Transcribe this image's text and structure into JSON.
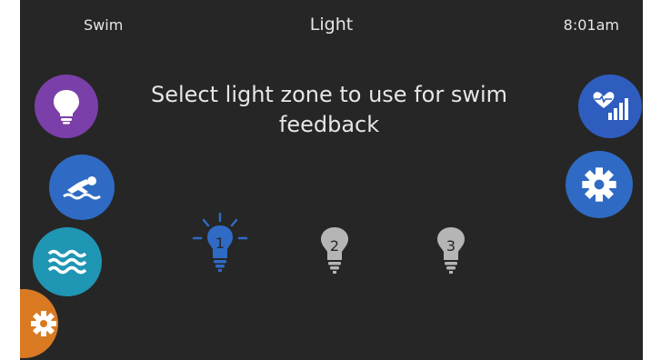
{
  "header": {
    "mode": "Swim",
    "title": "Light",
    "time": "8:01am"
  },
  "prompt": "Select light zone to use for swim feedback",
  "sidebar_left": [
    {
      "icon": "lightbulb-icon",
      "color": "#7a3fa8"
    },
    {
      "icon": "swimmer-icon",
      "color": "#2f6bc4"
    },
    {
      "icon": "waves-icon",
      "color": "#1f96b3"
    },
    {
      "icon": "gear-icon",
      "color": "#d97a22"
    }
  ],
  "sidebar_right": [
    {
      "icon": "heart-signal-icon",
      "color": "#2f5dbf"
    },
    {
      "icon": "gear-icon",
      "color": "#2f6bc4"
    }
  ],
  "zones": [
    {
      "number": "1",
      "selected": true,
      "color": "#2f6bc4"
    },
    {
      "number": "2",
      "selected": false,
      "color": "#b5b5b5"
    },
    {
      "number": "3",
      "selected": false,
      "color": "#b5b5b5"
    }
  ]
}
